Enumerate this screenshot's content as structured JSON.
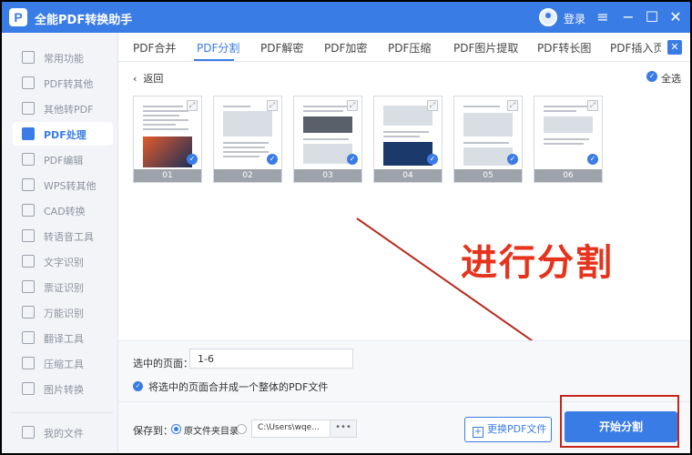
{
  "window": {
    "title": "全能PDF转换助手",
    "logo_text": "P",
    "login_label": "登录"
  },
  "titlebar_buttons": [
    "menu-icon",
    "minimize-icon",
    "maximize-icon",
    "close-icon"
  ],
  "sidebar": {
    "items": [
      {
        "label": "常用功能",
        "active": false
      },
      {
        "label": "PDF转其他",
        "active": false
      },
      {
        "label": "其他转PDF",
        "active": false
      },
      {
        "label": "PDF处理",
        "active": true
      },
      {
        "label": "PDF编辑",
        "active": false
      },
      {
        "label": "WPS转其他",
        "active": false
      },
      {
        "label": "CAD转换",
        "active": false
      },
      {
        "label": "转语音工具",
        "active": false
      },
      {
        "label": "文字识别",
        "active": false
      },
      {
        "label": "票证识别",
        "active": false
      },
      {
        "label": "万能识别",
        "active": false
      },
      {
        "label": "翻译工具",
        "active": false
      },
      {
        "label": "压缩工具",
        "active": false
      },
      {
        "label": "图片转换",
        "active": false
      }
    ],
    "bottom_item": {
      "label": "我的文件"
    }
  },
  "tabs": [
    {
      "label": "PDF合并",
      "active": false
    },
    {
      "label": "PDF分割",
      "active": true
    },
    {
      "label": "PDF解密",
      "active": false
    },
    {
      "label": "PDF加密",
      "active": false
    },
    {
      "label": "PDF压缩",
      "active": false
    },
    {
      "label": "PDF图片提取",
      "active": false
    },
    {
      "label": "PDF转长图",
      "active": false
    },
    {
      "label": "PDF插入页",
      "active": false
    }
  ],
  "close_tab_glyph": "✕",
  "back_label": "返回",
  "select_all_label": "全选",
  "pages": [
    {
      "number": "01",
      "checked": true,
      "caption": "图片加载式怎么显示？"
    },
    {
      "number": "02",
      "checked": true
    },
    {
      "number": "03",
      "checked": true
    },
    {
      "number": "04",
      "checked": true
    },
    {
      "number": "05",
      "checked": true
    },
    {
      "number": "06",
      "checked": true
    }
  ],
  "annotation": {
    "text": "进行分割",
    "color": "#e6331c"
  },
  "options": {
    "selected_pages_label": "选中的页面：",
    "selected_pages_value": "1-6",
    "merge_label": "将选中的页面合并成一个整体的PDF文件",
    "merge_checked": true
  },
  "save": {
    "label": "保存到：",
    "option_source": "原文件夹目录",
    "path_value": "C:\\Users\\wqe...",
    "more_label": "•••",
    "replace_button": "更换PDF文件",
    "start_button": "开始分割"
  },
  "colors": {
    "accent": "#3a7ce5",
    "highlight": "#c7241c"
  }
}
